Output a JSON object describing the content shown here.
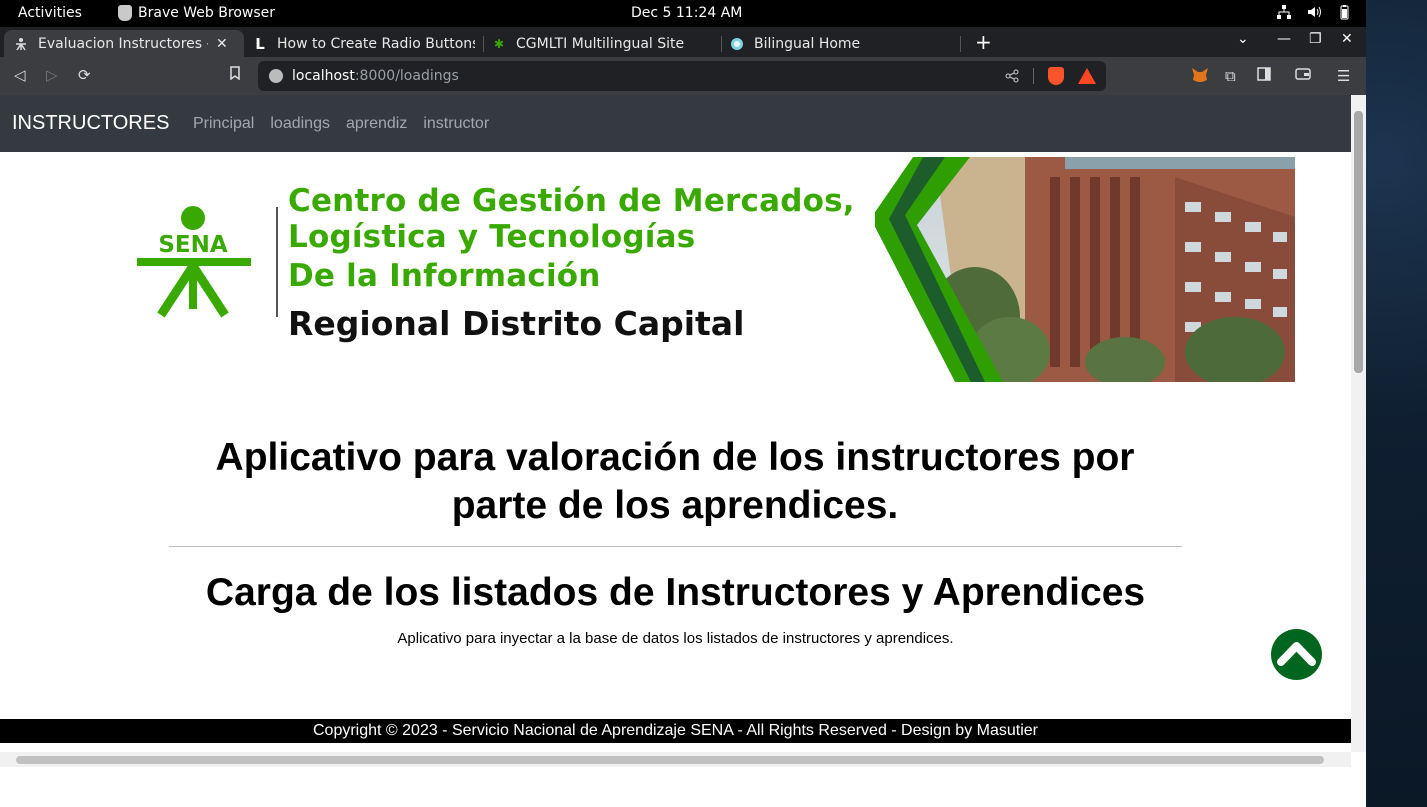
{
  "system_bar": {
    "activities": "Activities",
    "app_name": "Brave Web Browser",
    "clock": "Dec 5  11:24 AM"
  },
  "tabs": [
    {
      "label": "Evaluacion Instructores - l",
      "active": true,
      "favicon": "sena-icon"
    },
    {
      "label": "How to Create Radio Buttons",
      "active": false,
      "favicon": "L"
    },
    {
      "label": "CGMLTI Multilingual Site",
      "active": false,
      "favicon": "leaf-icon"
    },
    {
      "label": "Bilingual Home",
      "active": false,
      "favicon": "globe-icon"
    }
  ],
  "address_bar": {
    "host": "localhost",
    "path": ":8000/loadings"
  },
  "site_nav": {
    "brand": "INSTRUCTORES",
    "links": [
      "Principal",
      "loadings",
      "aprendiz",
      "instructor"
    ]
  },
  "banner": {
    "logo_text": "SENA",
    "line1": "Centro de Gestión de Mercados,",
    "line2": "Logística y Tecnologías",
    "line3": "De la Información",
    "line4": "Regional Distrito Capital",
    "accent_color": "#39a900"
  },
  "main": {
    "headline": "Aplicativo para valoración de los instructores por parte de los aprendices.",
    "subhead": "Carga de los listados de Instructores y Aprendices",
    "description": "Aplicativo para inyectar a la base de datos los listados de instructores y aprendices."
  },
  "footer": {
    "text": "Copyright © 2023 - Servicio Nacional de Aprendizaje SENA - All Rights Reserved - Design by Masutier"
  },
  "colors": {
    "navbar": "#343a40",
    "scroll_top_button": "#00651f"
  }
}
